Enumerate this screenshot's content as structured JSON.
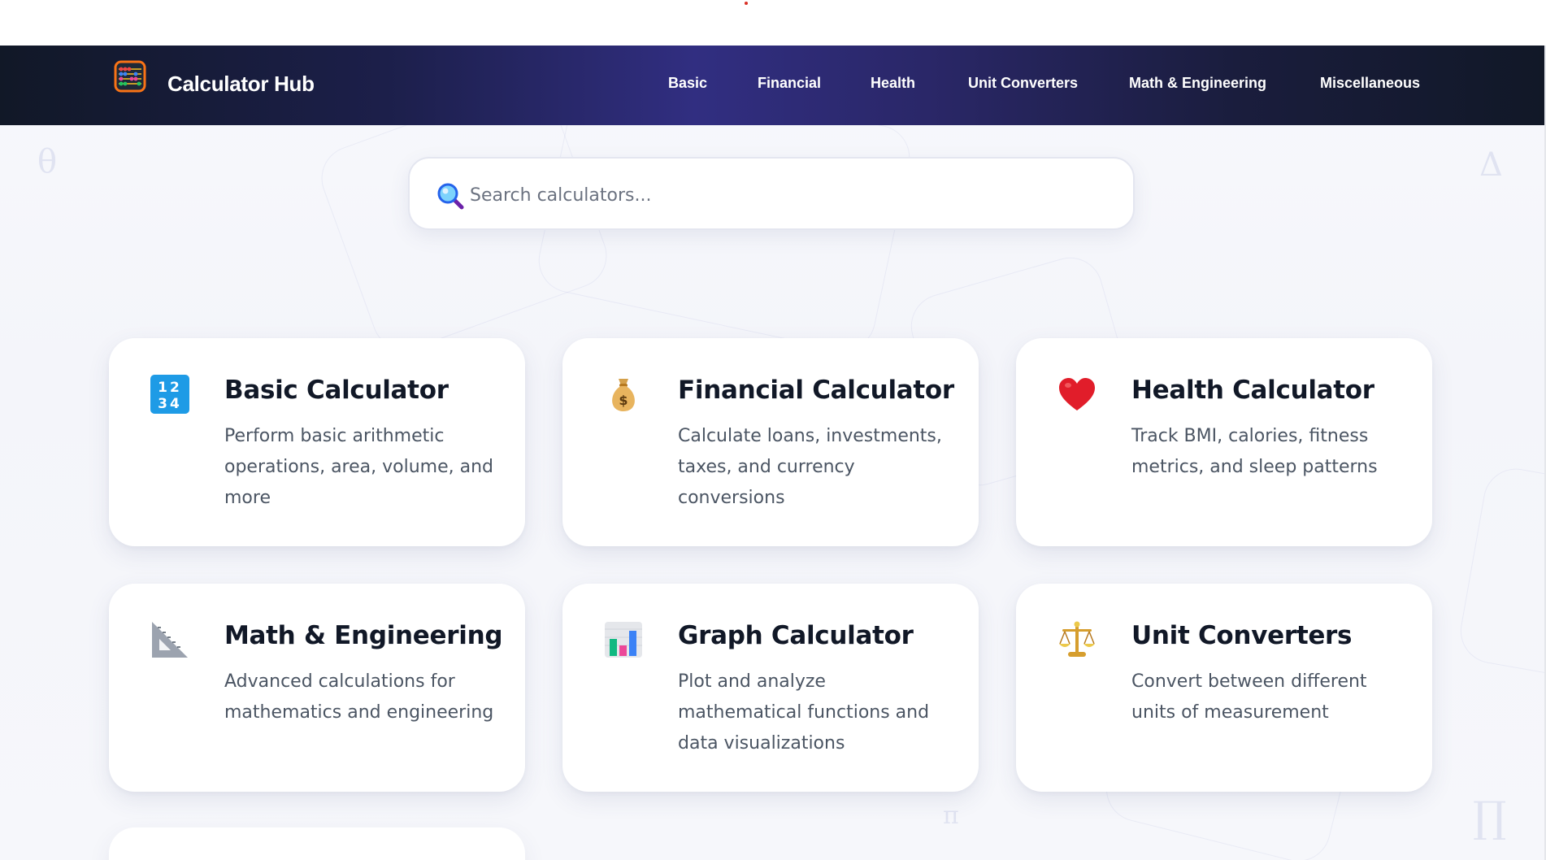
{
  "brand": {
    "name": "Calculator Hub",
    "icon": "abacus-icon"
  },
  "nav": {
    "items": [
      {
        "label": "Basic"
      },
      {
        "label": "Financial"
      },
      {
        "label": "Health"
      },
      {
        "label": "Unit Converters"
      },
      {
        "label": "Math & Engineering"
      },
      {
        "label": "Miscellaneous"
      }
    ]
  },
  "search": {
    "placeholder": "Search calculators...",
    "value": "",
    "icon": "magnifier-icon"
  },
  "cards": [
    {
      "title": "Basic Calculator",
      "description": "Perform basic arithmetic operations, area, volume, and more",
      "icon": "numbers-1234-icon"
    },
    {
      "title": "Financial Calculator",
      "description": "Calculate loans, investments, taxes, and currency conversions",
      "icon": "money-bag-icon"
    },
    {
      "title": "Health Calculator",
      "description": "Track BMI, calories, fitness metrics, and sleep patterns",
      "icon": "heart-icon"
    },
    {
      "title": "Math & Engineering",
      "description": "Advanced calculations for mathematics and engineering",
      "icon": "triangular-ruler-icon"
    },
    {
      "title": "Graph Calculator",
      "description": "Plot and analyze mathematical functions and data visualizations",
      "icon": "bar-chart-icon"
    },
    {
      "title": "Unit Converters",
      "description": "Convert between different units of measurement",
      "icon": "balance-scale-icon"
    }
  ],
  "colors": {
    "nav_dark": "#111827",
    "nav_accent": "#312e81",
    "card_bg": "#ffffff",
    "title_text": "#111827",
    "body_text": "#4b5563"
  }
}
